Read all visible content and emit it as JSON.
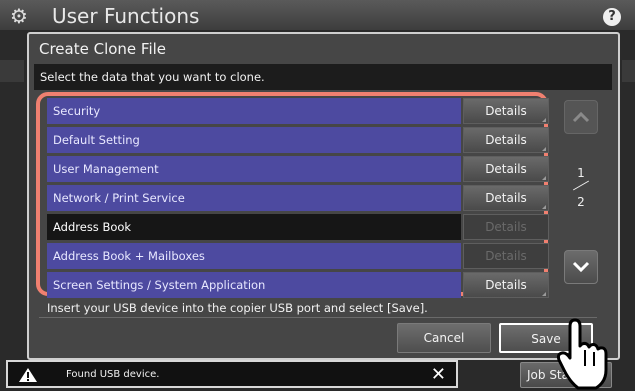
{
  "app": {
    "title": "User Functions",
    "help_label": "?"
  },
  "dialog": {
    "title": "Create Clone File",
    "instruction": "Select the data that you want to clone.",
    "rows": [
      {
        "label": "Security",
        "details": "Details",
        "selected": false,
        "details_enabled": true
      },
      {
        "label": "Default Setting",
        "details": "Details",
        "selected": false,
        "details_enabled": true
      },
      {
        "label": "User Management",
        "details": "Details",
        "selected": false,
        "details_enabled": true
      },
      {
        "label": "Network / Print Service",
        "details": "Details",
        "selected": false,
        "details_enabled": true
      },
      {
        "label": "Address Book",
        "details": "Details",
        "selected": true,
        "details_enabled": false
      },
      {
        "label": "Address Book + Mailboxes",
        "details": "Details",
        "selected": false,
        "details_enabled": false
      },
      {
        "label": "Screen Settings / System Application",
        "details": "Details",
        "selected": false,
        "details_enabled": true
      }
    ],
    "page": {
      "current": "1",
      "total": "2"
    },
    "usb_instruction": "Insert your USB device into the copier USB port and select [Save].",
    "cancel_label": "Cancel",
    "save_label": "Save"
  },
  "status_bar": {
    "message": "Found USB device.",
    "icons": [
      "warning-icon",
      "close-icon"
    ]
  },
  "job_status_label": "Job Status",
  "colors": {
    "row_blue": "#4d4aa0",
    "selected_row": "#161616",
    "highlight_frame": "#f08070"
  }
}
